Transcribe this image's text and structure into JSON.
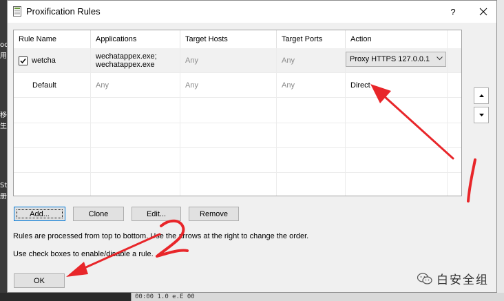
{
  "window": {
    "title": "Proxification Rules",
    "help_label": "?",
    "icon": "rules-document-icon"
  },
  "table": {
    "columns": [
      "Rule Name",
      "Applications",
      "Target Hosts",
      "Target Ports",
      "Action"
    ],
    "rows": [
      {
        "checked": true,
        "name": "wetcha",
        "applications_line1": "wechatappex.exe;",
        "applications_line2": "wechatappex.exe",
        "hosts": "Any",
        "ports": "Any",
        "action": "Proxy HTTPS 127.0.0.1"
      },
      {
        "checked": null,
        "name": "Default",
        "applications": "Any",
        "hosts": "Any",
        "ports": "Any",
        "action": "Direct"
      }
    ]
  },
  "buttons": {
    "add": "Add...",
    "clone": "Clone",
    "edit": "Edit...",
    "remove": "Remove",
    "ok": "OK"
  },
  "notes": {
    "order": "Rules are processed from top to bottom. Use the arrows at the right to change the order.",
    "checkbox": "Use check boxes to enable/disable a rule."
  },
  "annotations": {
    "marker1": "1",
    "marker2": "2",
    "color": "#e8262a"
  },
  "watermark": {
    "text": "白安全组",
    "icon": "wechat-icon"
  },
  "background": {
    "left_chars": [
      "oc",
      "用",
      "移",
      "生",
      "St",
      "册"
    ],
    "bottom_text": "00:00 1.0 e.E 00"
  }
}
